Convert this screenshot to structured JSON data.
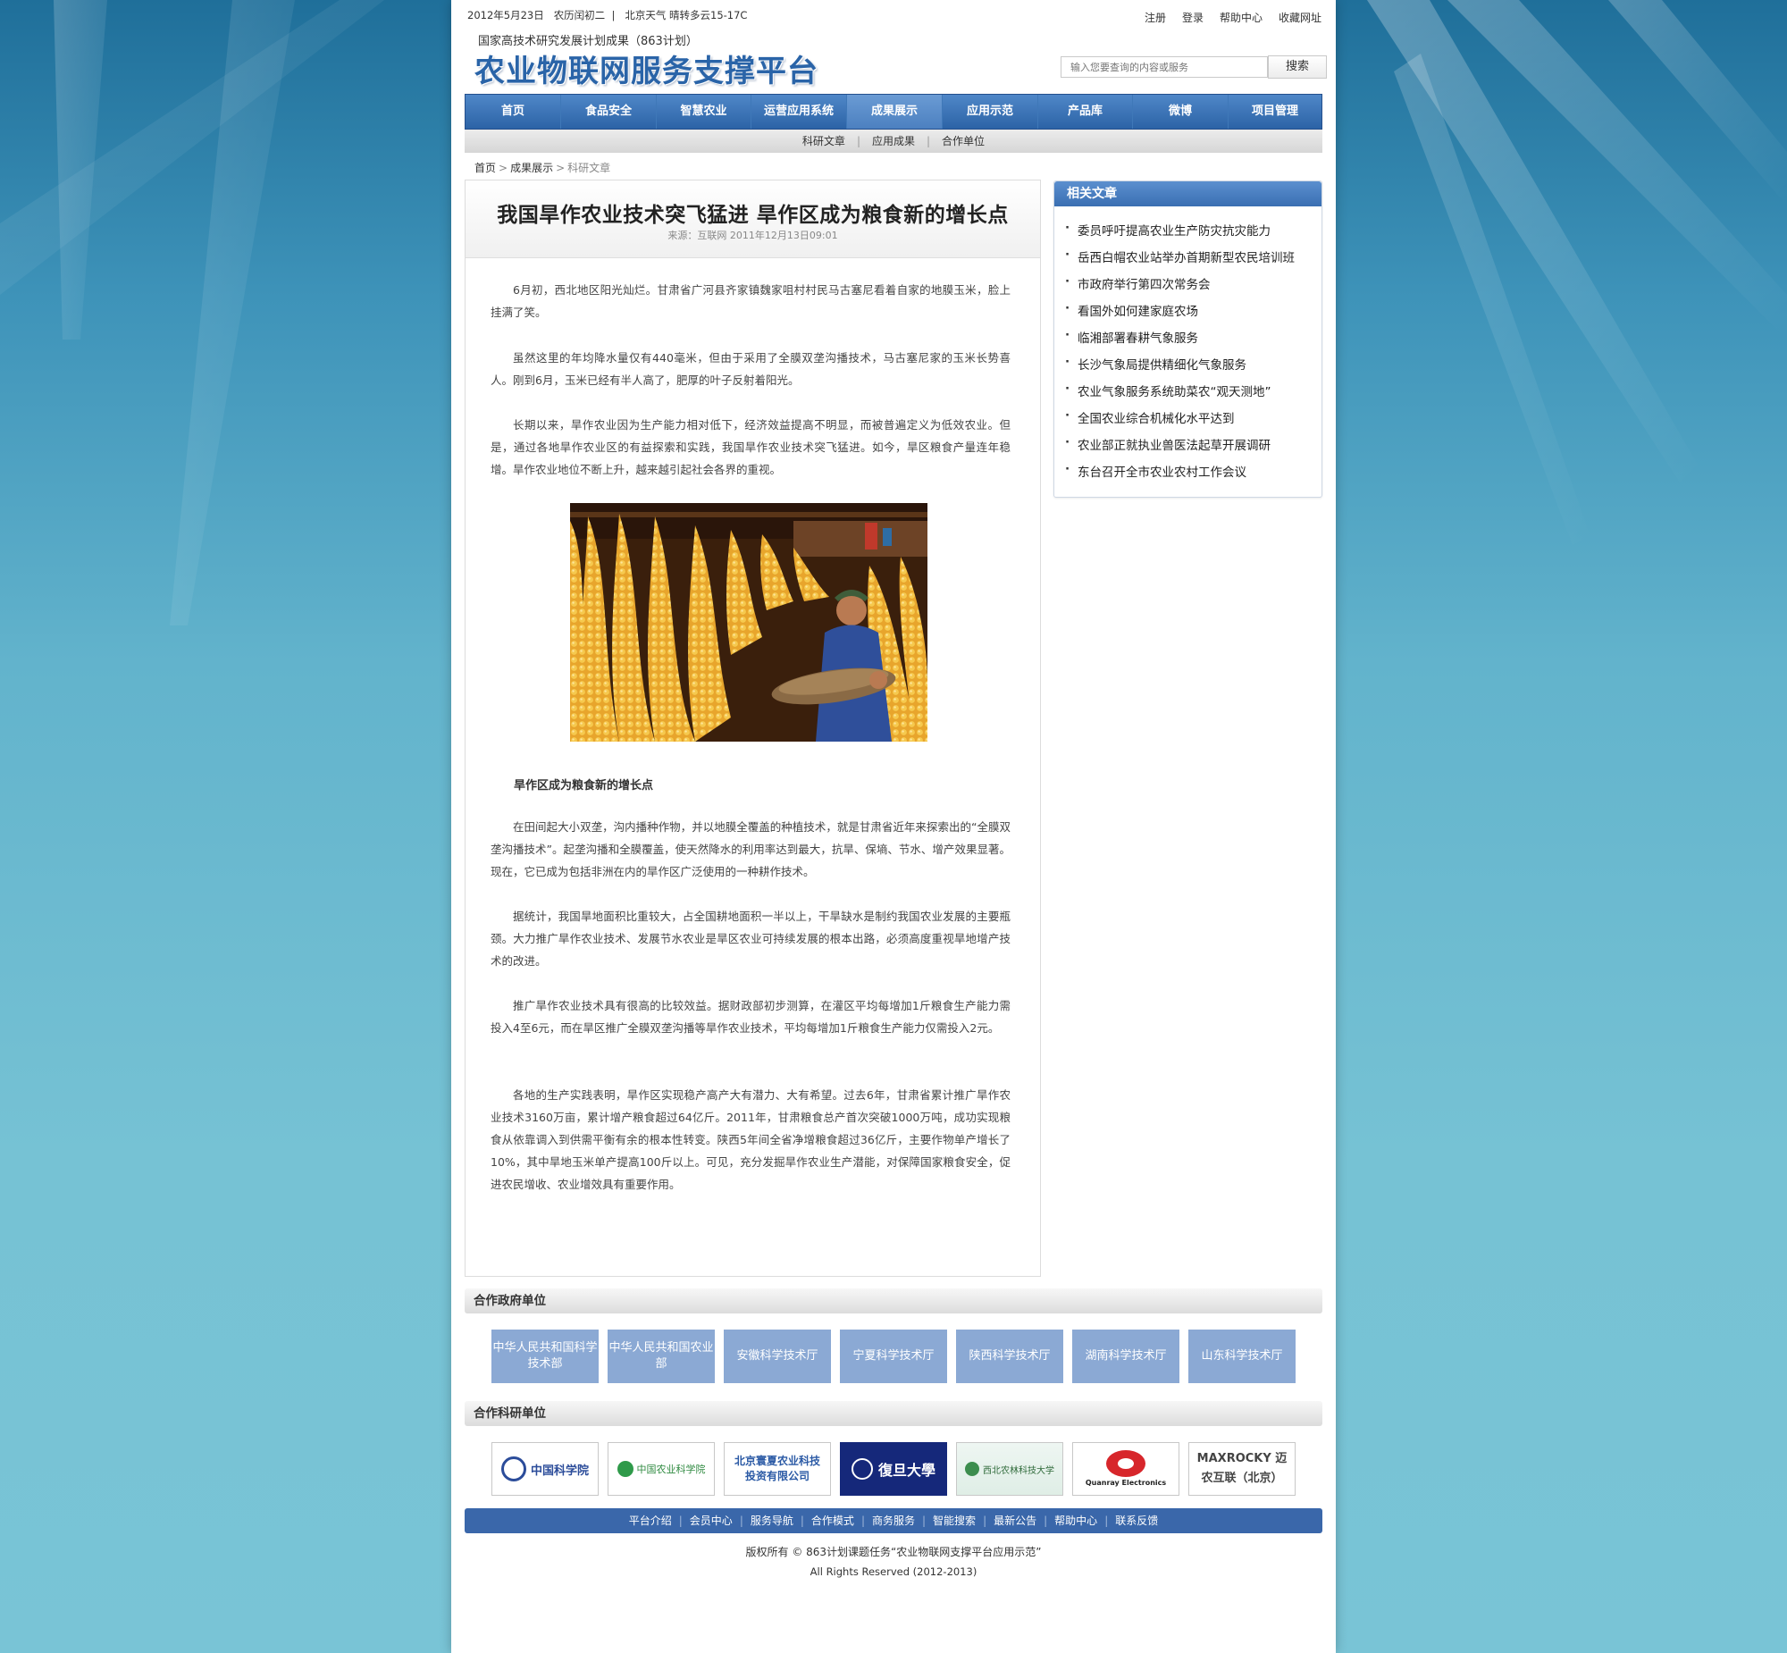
{
  "topbar": {
    "date": "2012年5月23日",
    "lunar": "农历闰初二",
    "weather": "北京天气  晴转多云15-17C",
    "links": [
      "注册",
      "登录",
      "帮助中心",
      "收藏网址"
    ]
  },
  "header": {
    "subtitle": "国家高技术研究发展计划成果（863计划）",
    "logo": "农业物联网服务支撑平台",
    "search_placeholder": "输入您要查询的内容或服务",
    "search_button": "搜索"
  },
  "nav": {
    "items": [
      "首页",
      "食品安全",
      "智慧农业",
      "运营应用系统",
      "成果展示",
      "应用示范",
      "产品库",
      "微博",
      "项目管理"
    ],
    "active_index": 4,
    "sub": [
      "科研文章",
      "应用成果",
      "合作单位"
    ]
  },
  "breadcrumb": [
    "首页",
    "成果展示",
    "科研文章"
  ],
  "article": {
    "title": "我国旱作农业技术突飞猛进 旱作区成为粮食新的增长点",
    "meta": "来源：互联网    2011年12月13日09:01",
    "p1": "6月初，西北地区阳光灿烂。甘肃省广河县齐家镇魏家咀村村民马古塞尼看着自家的地膜玉米，脸上挂满了笑。",
    "p2": "虽然这里的年均降水量仅有440毫米，但由于采用了全膜双垄沟播技术，马古塞尼家的玉米长势喜人。刚到6月，玉米已经有半人高了，肥厚的叶子反射着阳光。",
    "p3": "长期以来，旱作农业因为生产能力相对低下，经济效益提高不明显，而被普遍定义为低效农业。但是，通过各地旱作农业区的有益探索和实践，我国旱作农业技术突飞猛进。如今，旱区粮食产量连年稳增。旱作农业地位不断上升，越来越引起社会各界的重视。",
    "subhead": "旱作区成为粮食新的增长点",
    "p4": "在田间起大小双垄，沟内播种作物，并以地膜全覆盖的种植技术，就是甘肃省近年来探索出的“全膜双垄沟播技术”。起垄沟播和全膜覆盖，使天然降水的利用率达到最大，抗旱、保墒、节水、增产效果显著。现在，它已成为包括非洲在内的旱作区广泛使用的一种耕作技术。",
    "p5": "据统计，我国旱地面积比重较大，占全国耕地面积一半以上，干旱缺水是制约我国农业发展的主要瓶颈。大力推广旱作农业技术、发展节水农业是旱区农业可持续发展的根本出路，必须高度重视旱地增产技术的改进。",
    "p6": "推广旱作农业技术具有很高的比较效益。据财政部初步测算，在灌区平均每增加1斤粮食生产能力需投入4至6元，而在旱区推广全膜双垄沟播等旱作农业技术，平均每增加1斤粮食生产能力仅需投入2元。",
    "p7": "各地的生产实践表明，旱作区实现稳产高产大有潜力、大有希望。过去6年，甘肃省累计推广旱作农业技术3160万亩，累计增产粮食超过64亿斤。2011年，甘肃粮食总产首次突破1000万吨，成功实现粮食从依靠调入到供需平衡有余的根本性转变。陕西5年间全省净增粮食超过36亿斤，主要作物单产增长了10%，其中旱地玉米单产提高100斤以上。可见，充分发掘旱作农业生产潜能，对保障国家粮食安全，促进农民增收、农业增效具有重要作用。"
  },
  "related": {
    "title": "相关文章",
    "items": [
      "委员呼吁提高农业生产防灾抗灾能力",
      "岳西白帽农业站举办首期新型农民培训班",
      "市政府举行第四次常务会",
      "看国外如何建家庭农场",
      "临湘部署春耕气象服务",
      "长沙气象局提供精细化气象服务",
      "农业气象服务系统助菜农“观天测地”",
      "全国农业综合机械化水平达到",
      "农业部正就执业兽医法起草开展调研",
      "东台召开全市农业农村工作会议"
    ]
  },
  "partners_gov": {
    "title": "合作政府单位",
    "items": [
      "中华人民共和国科学技术部",
      "中华人民共和国农业部",
      "安徽科学技术厅",
      "宁夏科学技术厅",
      "陕西科学技术厅",
      "湖南科学技术厅",
      "山东科学技术厅"
    ]
  },
  "partners_research": {
    "title": "合作科研单位",
    "items": [
      "中国科学院",
      "中国农业科学院",
      "北京寰夏农业科技投资有限公司",
      "復旦大學",
      "西北农林科技大学",
      "Quanray Electronics",
      "MAXROCKY 迈农互联（北京）"
    ]
  },
  "footer": {
    "links": [
      "平台介绍",
      "会员中心",
      "服务导航",
      "合作模式",
      "商务服务",
      "智能搜索",
      "最新公告",
      "帮助中心",
      "联系反馈"
    ],
    "copyright": "版权所有 © 863计划课题任务“农业物联网支撑平台应用示范”",
    "rights": "All Rights Reserved (2012-2013)"
  },
  "colors": {
    "nav": "#2c63a6",
    "accent": "#3a67aa",
    "gov_tile": "#8ba9d4",
    "background": "#76c2d4"
  }
}
